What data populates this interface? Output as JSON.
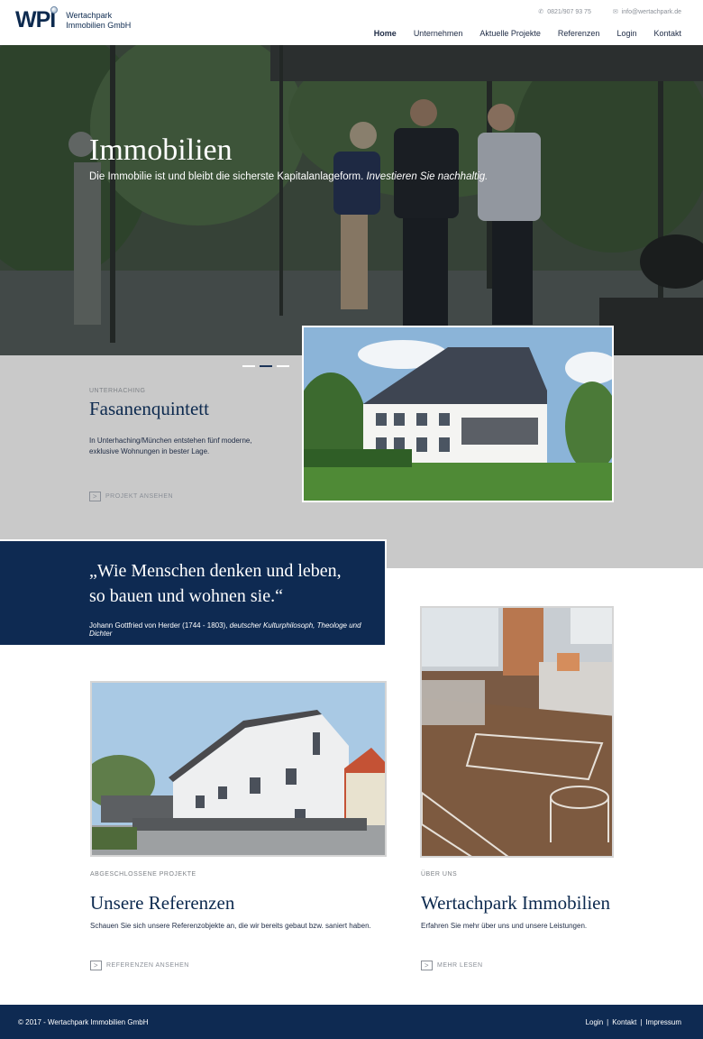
{
  "header": {
    "logo_mark": "WPI",
    "logo_line1": "Wertachpark",
    "logo_line2": "Immobilien GmbH",
    "phone": "0821/907 93 75",
    "email": "info@wertachpark.de",
    "nav": [
      "Home",
      "Unternehmen",
      "Aktuelle Projekte",
      "Referenzen",
      "Login",
      "Kontakt"
    ]
  },
  "hero": {
    "title": "Immobilien",
    "subtitle": "Die Immobilie ist und bleibt die sicherste Kapitalanlageform.",
    "subtitle_italic": "Investieren Sie nachhaltig."
  },
  "project": {
    "eyebrow": "UNTERHACHING",
    "title": "Fasanenquintett",
    "text": "In Unterhaching/München entstehen fünf moderne, exklusive Wohnungen in bester Lage.",
    "link_icon": ">",
    "link": "PROJEKT ANSEHEN"
  },
  "quote": {
    "line1": "„Wie Menschen denken und leben,",
    "line2": "so bauen und wohnen sie.“",
    "author": "Johann Gottfried von Herder (1744 - 1803),",
    "author_italic": "deutscher Kulturphilosoph, Theologe und Dichter"
  },
  "references": {
    "eyebrow": "ABGESCHLOSSENE PROJEKTE",
    "title": "Unsere Referenzen",
    "text": "Schauen Sie sich unsere Referenzobjekte an, die wir bereits gebaut bzw. saniert haben.",
    "link": "REFERENZEN ANSEHEN"
  },
  "about": {
    "eyebrow": "ÜBER UNS",
    "title": "Wertachpark Immobilien",
    "text": "Erfahren Sie mehr über uns und unsere Leistungen.",
    "link": "MEHR LESEN"
  },
  "footer": {
    "copyright": "© 2017 - Wertachpark Immobilien GmbH",
    "links": [
      "Login",
      "Kontakt",
      "Impressum"
    ],
    "separator": "|"
  }
}
